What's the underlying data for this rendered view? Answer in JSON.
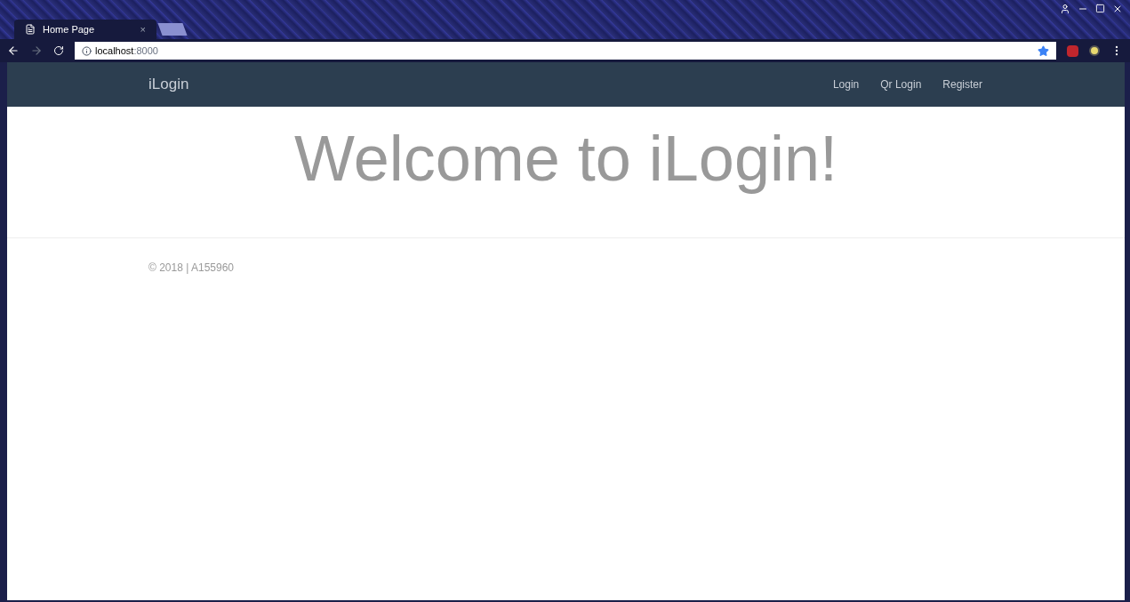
{
  "browser": {
    "tab": {
      "title": "Home Page",
      "close": "×",
      "selected": true
    },
    "address": "**localhost**:8000"
  },
  "navbar": {
    "brand": "iLogin",
    "links": [
      {
        "label": "Login"
      },
      {
        "label": "Qr Login"
      },
      {
        "label": "Register"
      }
    ]
  },
  "hero": {
    "heading": "Welcome to iLogin!"
  },
  "footer": {
    "text": "© 2018 | A155960"
  }
}
